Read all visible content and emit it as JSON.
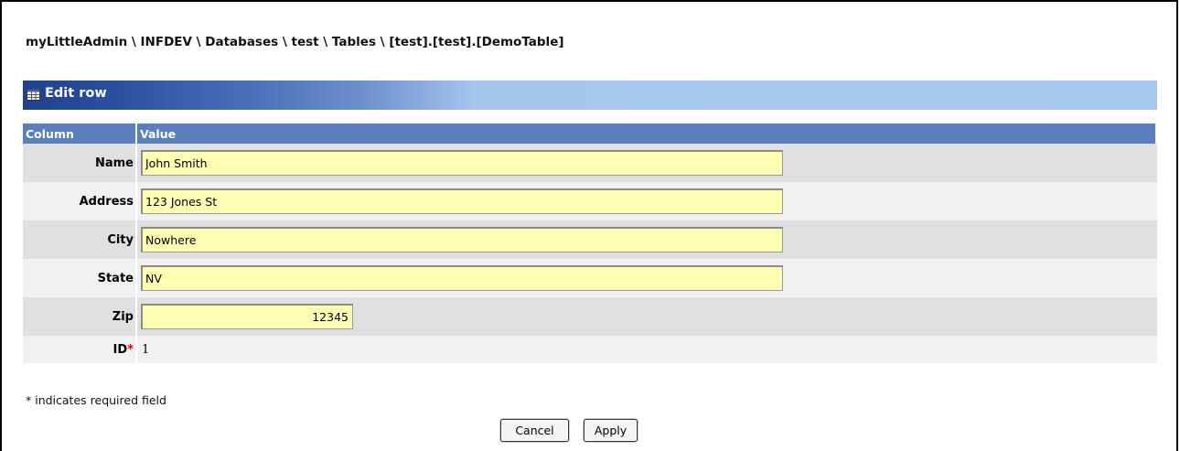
{
  "breadcrumb": "myLittleAdmin \\ INFDEV \\ Databases \\ test \\ Tables \\ [test].[test].[DemoTable]",
  "panel": {
    "title": "Edit row",
    "icon": "table-grid-icon"
  },
  "table": {
    "headers": {
      "column": "Column",
      "value": "Value"
    },
    "rows": [
      {
        "label": "Name",
        "value": "John Smith"
      },
      {
        "label": "Address",
        "value": "123 Jones St"
      },
      {
        "label": "City",
        "value": "Nowhere"
      },
      {
        "label": "State",
        "value": "NV"
      },
      {
        "label": "Zip",
        "value": "12345"
      }
    ],
    "id_row": {
      "label": "ID",
      "required_mark": "*",
      "value": "1"
    }
  },
  "footnote": "* indicates required field",
  "buttons": {
    "cancel": "Cancel",
    "apply": "Apply"
  },
  "colors": {
    "header_dark": "#21418f",
    "header_light": "#a6c9f0",
    "column_header": "#5a7fbe",
    "field_bg": "#ffffb4"
  }
}
